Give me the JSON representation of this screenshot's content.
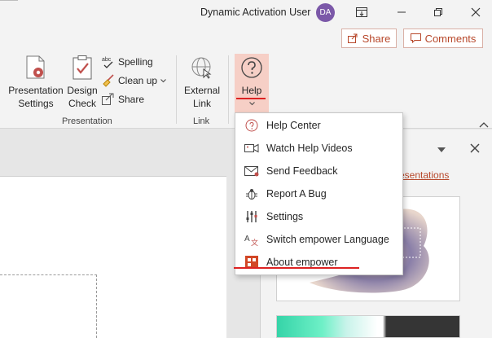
{
  "titlebar": {
    "user_name": "Dynamic Activation User",
    "avatar_initials": "DA",
    "avatar_color": "#7b58a8"
  },
  "share_row": {
    "share_label": "Share",
    "comments_label": "Comments",
    "accent": "#b7472a"
  },
  "ribbon": {
    "presentation_settings_label": "Presentation Settings",
    "presentation_settings_line1": "Presentation",
    "presentation_settings_line2": "Settings",
    "design_check_line1": "Design",
    "design_check_line2": "Check",
    "spelling_label": "Spelling",
    "cleanup_label": "Clean up",
    "share_label": "Share",
    "external_link_line1": "External",
    "external_link_line2": "Link",
    "help_label": "Help",
    "group_presentation": "Presentation",
    "group_link": "Link"
  },
  "pane": {
    "link_text": "esentations"
  },
  "help_menu": {
    "items": [
      {
        "label": "Help Center",
        "icon": "question-circle-icon"
      },
      {
        "label": "Watch Help Videos",
        "icon": "video-icon"
      },
      {
        "label": "Send Feedback",
        "icon": "envelope-icon"
      },
      {
        "label": "Report A Bug",
        "icon": "bug-icon"
      },
      {
        "label": "Settings",
        "icon": "sliders-icon"
      },
      {
        "label": "Switch empower Language",
        "icon": "language-icon"
      },
      {
        "label": "About empower",
        "icon": "empower-logo-icon"
      }
    ]
  },
  "colors": {
    "highlight_red": "#dd2222",
    "help_button_bg": "#f6cfc6",
    "link_orange": "#b7472a"
  }
}
